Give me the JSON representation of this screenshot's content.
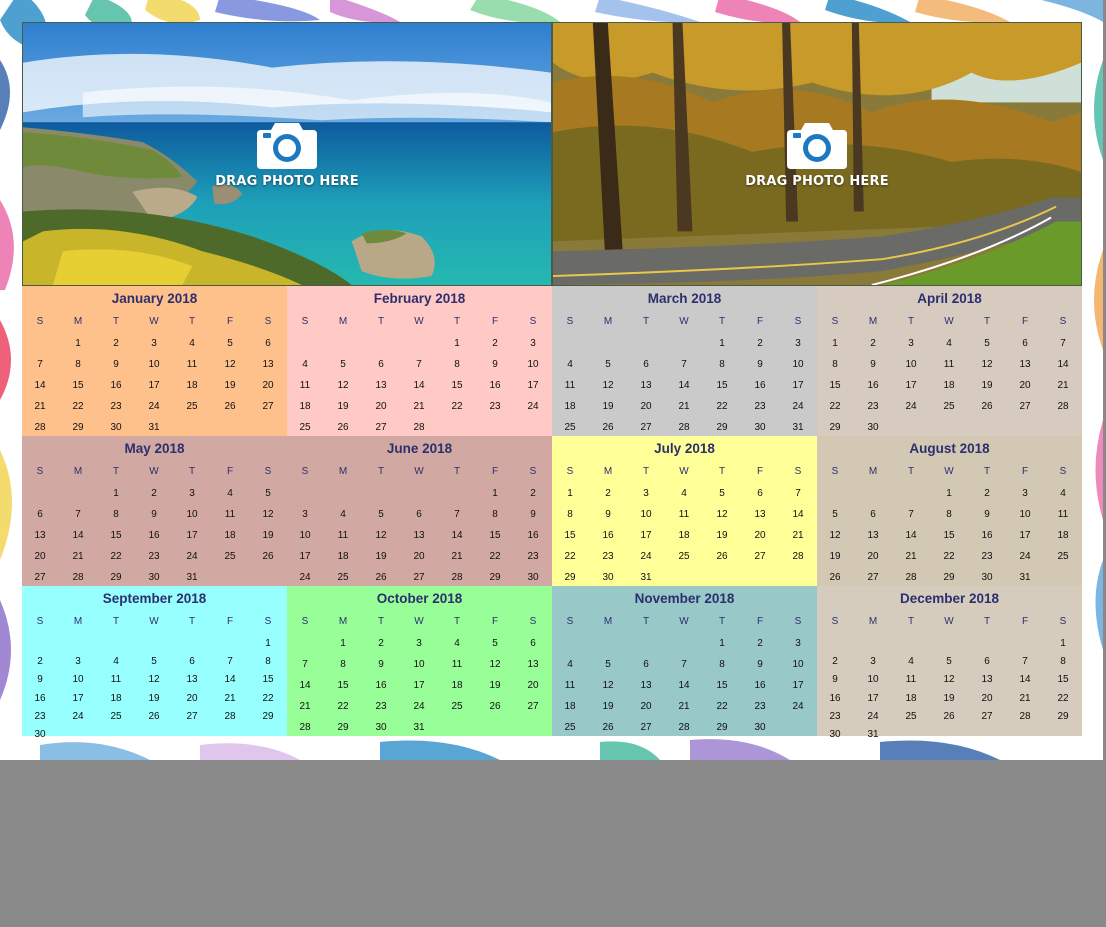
{
  "photos": [
    {
      "label": "DRAG PHOTO HERE",
      "scene": "coast"
    },
    {
      "label": "DRAG PHOTO HERE",
      "scene": "forest-road"
    }
  ],
  "weekday_headers": [
    "S",
    "M",
    "T",
    "W",
    "T",
    "F",
    "S"
  ],
  "months": [
    {
      "title": "January 2018",
      "color": "#ffc18c",
      "start": 1,
      "days": 31
    },
    {
      "title": "February 2018",
      "color": "#ffc9c6",
      "start": 4,
      "days": 28
    },
    {
      "title": "March 2018",
      "color": "#cacaca",
      "start": 4,
      "days": 31
    },
    {
      "title": "April 2018",
      "color": "#d7cabe",
      "start": 0,
      "days": 30
    },
    {
      "title": "May 2018",
      "color": "#d2a9a2",
      "start": 2,
      "days": 31
    },
    {
      "title": "June 2018",
      "color": "#d2a9a2",
      "start": 5,
      "days": 30
    },
    {
      "title": "July 2018",
      "color": "#ffff98",
      "start": 0,
      "days": 31
    },
    {
      "title": "August 2018",
      "color": "#d2c8b4",
      "start": 3,
      "days": 31
    },
    {
      "title": "September 2018",
      "color": "#98ffff",
      "start": 6,
      "days": 30
    },
    {
      "title": "October 2018",
      "color": "#98ff98",
      "start": 1,
      "days": 31
    },
    {
      "title": "November 2018",
      "color": "#98c8c8",
      "start": 4,
      "days": 30
    },
    {
      "title": "December 2018",
      "color": "#d5ccbd",
      "start": 6,
      "days": 31
    }
  ]
}
